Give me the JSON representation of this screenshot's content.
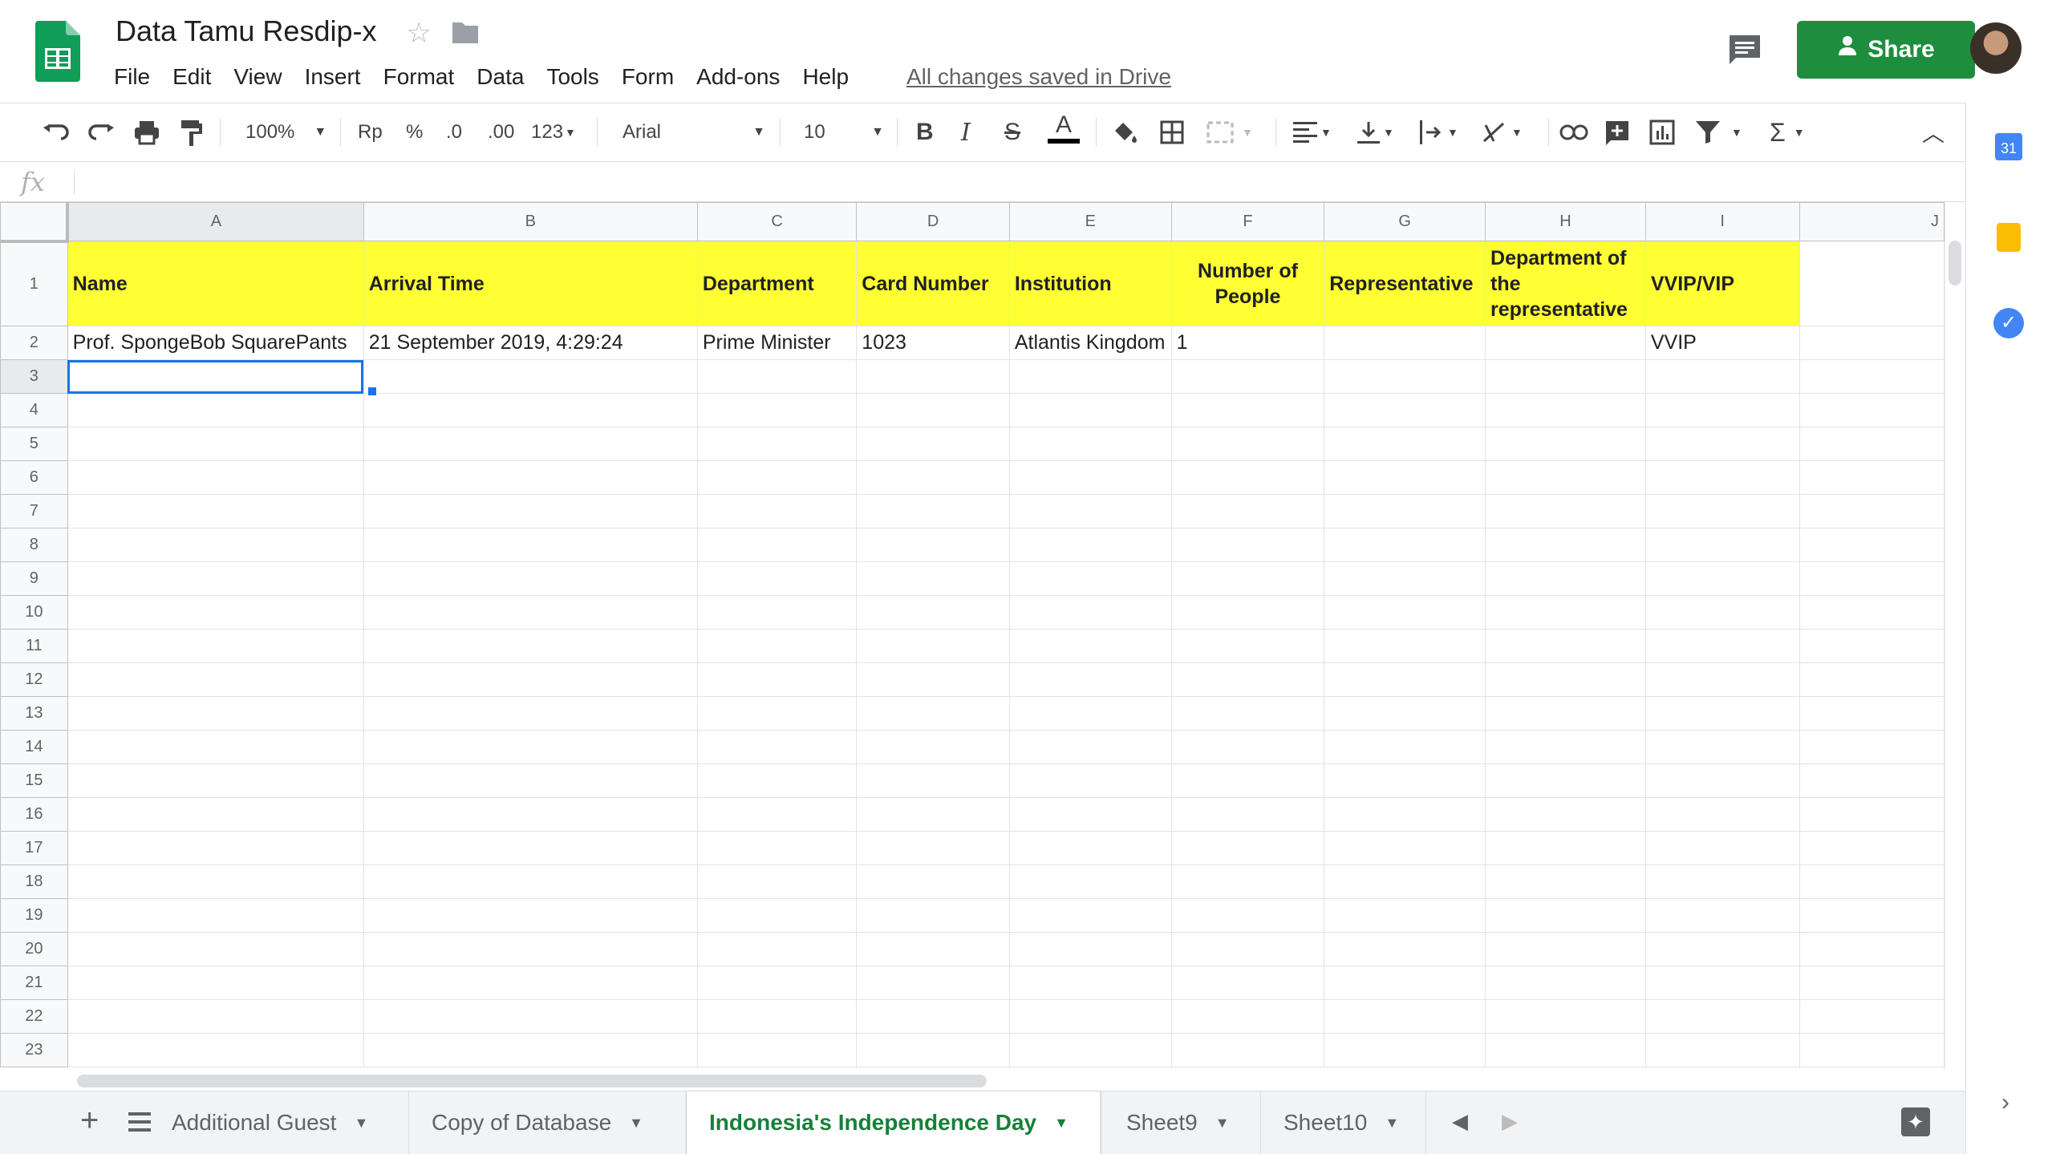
{
  "app": {
    "doc_title": "Data Tamu Resdip-x",
    "saved_status": "All changes saved in Drive",
    "share_label": "Share"
  },
  "menu": [
    "File",
    "Edit",
    "View",
    "Insert",
    "Format",
    "Data",
    "Tools",
    "Form",
    "Add-ons",
    "Help"
  ],
  "toolbar": {
    "zoom": "100%",
    "currency": "Rp",
    "percent": "%",
    "dec_less": ".0",
    "dec_more": ".00",
    "more_formats": "123",
    "font": "Arial",
    "font_size": "10",
    "bold": "B",
    "italic": "I",
    "strike": "S",
    "text_color": "A",
    "function_sym": "Σ"
  },
  "formula_bar": {
    "fx": "fx"
  },
  "grid": {
    "columns": [
      "A",
      "B",
      "C",
      "D",
      "E",
      "F",
      "G",
      "H",
      "I",
      "J"
    ],
    "row_numbers": [
      "1",
      "2",
      "3",
      "4",
      "5",
      "6",
      "7",
      "8",
      "9",
      "10",
      "11",
      "12",
      "13",
      "14",
      "15",
      "16",
      "17",
      "18",
      "19",
      "20",
      "21",
      "22",
      "23"
    ],
    "header_row": [
      "Name",
      "Arrival Time",
      "Department",
      "Card Number",
      "Institution",
      "Number of People",
      "Representative",
      "Department of the representative",
      "VVIP/VIP",
      ""
    ],
    "data_row": [
      "Prof. SpongeBob SquarePants",
      "21 September 2019, 4:29:24",
      "Prime Minister",
      "1023",
      "Atlantis Kingdom",
      "1",
      "",
      "",
      "VVIP",
      ""
    ],
    "header_fill": "#ffff33",
    "selected_cell": "A3"
  },
  "sheets": {
    "tabs": [
      "Additional Guest",
      "Copy of Database",
      "Indonesia's Independence Day",
      "Sheet9",
      "Sheet10"
    ],
    "active": "Indonesia's Independence Day",
    "active_color": "#188038"
  },
  "side_panel": {
    "calendar_label": "31"
  }
}
